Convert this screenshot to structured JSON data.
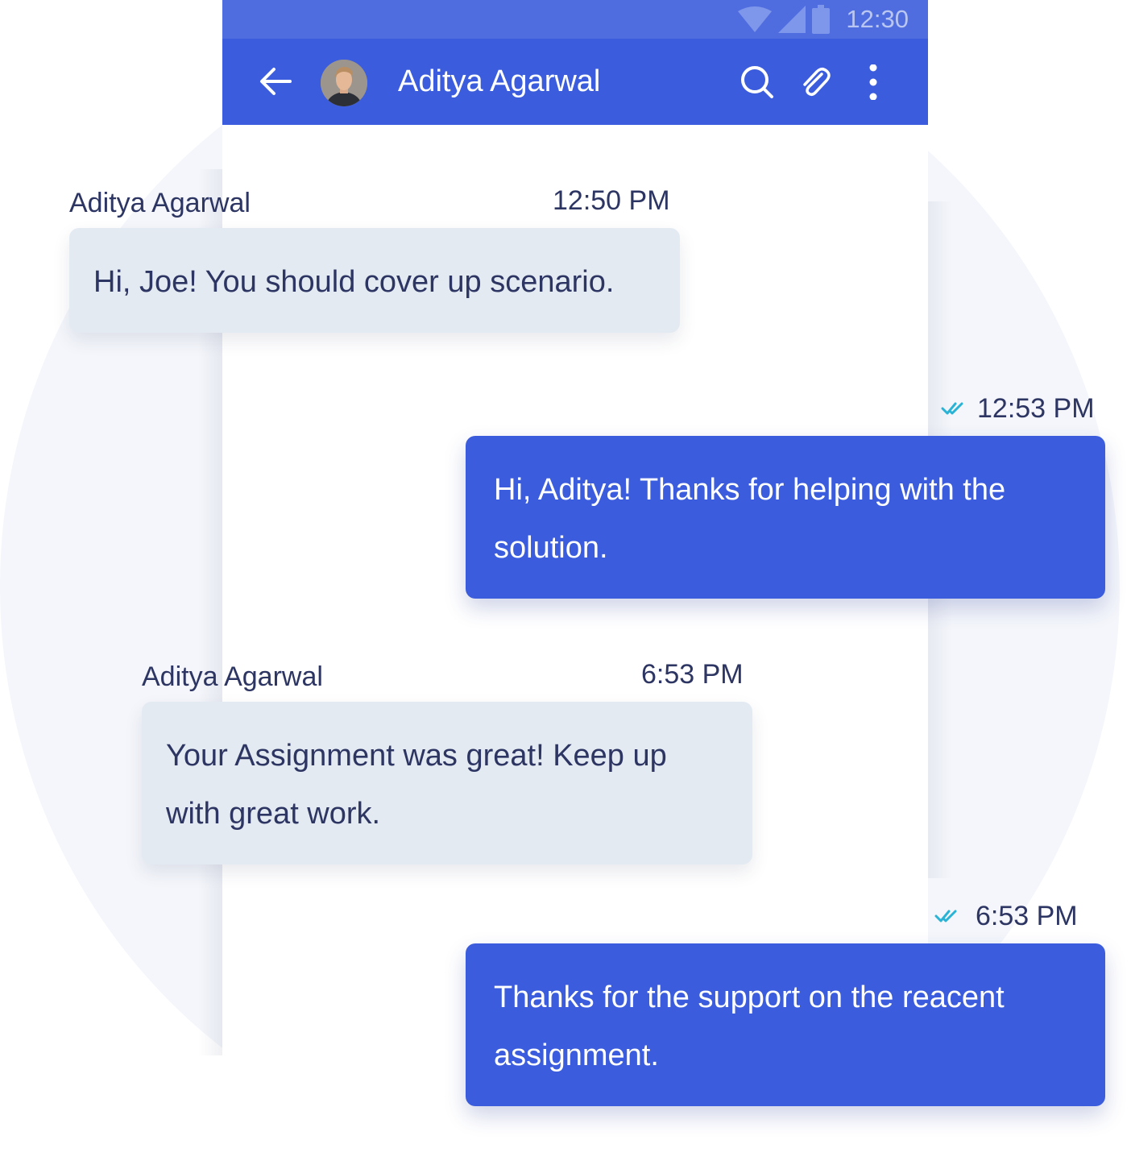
{
  "status_bar": {
    "time": "12:30",
    "icons": [
      "wifi-icon",
      "signal-icon",
      "battery-icon"
    ]
  },
  "app_bar": {
    "back_icon": "arrow-left-icon",
    "contact_name": "Aditya Agarwal",
    "actions": [
      "search-icon",
      "attachment-icon",
      "more-vertical-icon"
    ]
  },
  "messages": [
    {
      "direction": "incoming",
      "sender": "Aditya Agarwal",
      "time": "12:50 PM",
      "text": "Hi, Joe! You should cover up scenario."
    },
    {
      "direction": "outgoing",
      "time": "12:53 PM",
      "status": "read",
      "text": "Hi, Aditya! Thanks for helping with the solution."
    },
    {
      "direction": "incoming",
      "sender": "Aditya Agarwal",
      "time": "6:53 PM",
      "text": "Your Assignment was great! Keep up with great work."
    },
    {
      "direction": "outgoing",
      "time": "6:53 PM",
      "status": "read",
      "text": "Thanks for the support on the reacent assignment."
    }
  ],
  "colors": {
    "primary": "#3b5ddd",
    "status_bar": "#4f6ddf",
    "incoming_bubble": "#e3eaf2",
    "text_dark": "#2d3562",
    "read_check": "#2bb3d6",
    "background_circle": "#f4f6fb"
  }
}
